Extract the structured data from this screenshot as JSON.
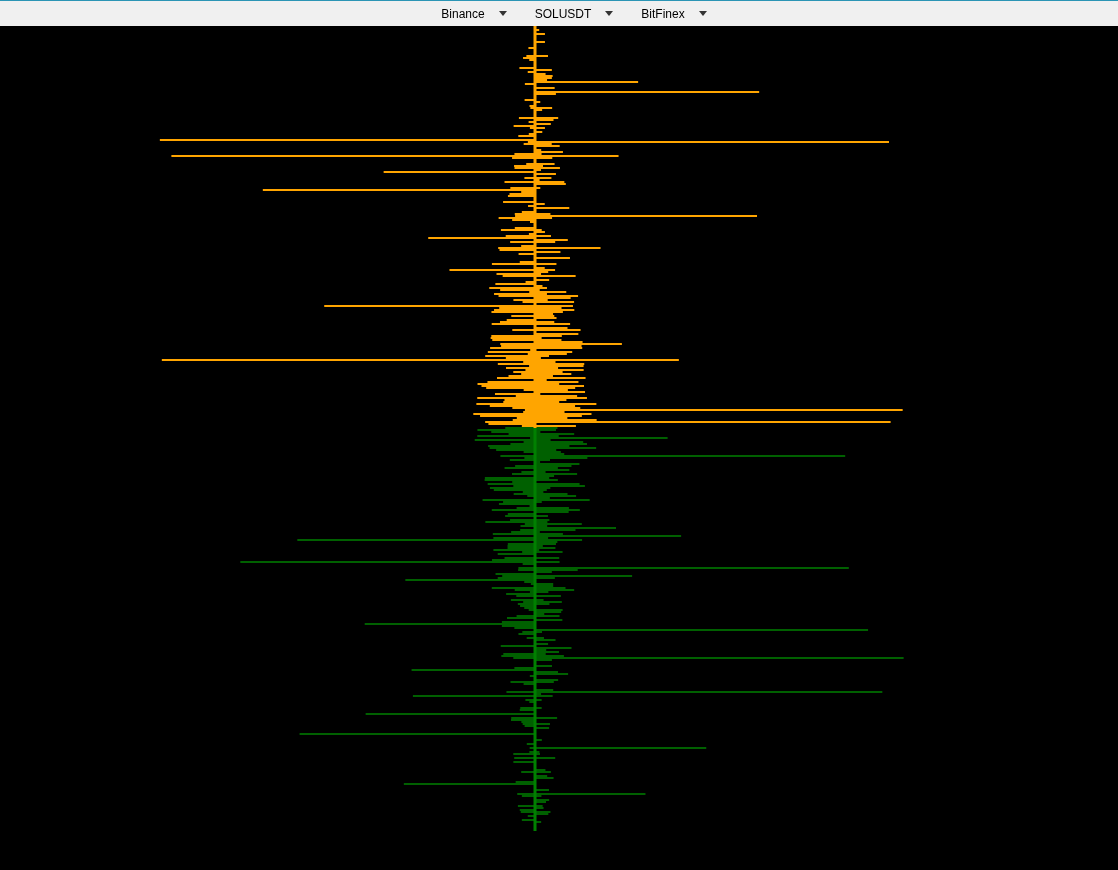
{
  "toolbar": {
    "dropdowns": [
      {
        "value": "Binance"
      },
      {
        "value": "SOLUSDT"
      },
      {
        "value": "BitFinex"
      }
    ]
  }
}
